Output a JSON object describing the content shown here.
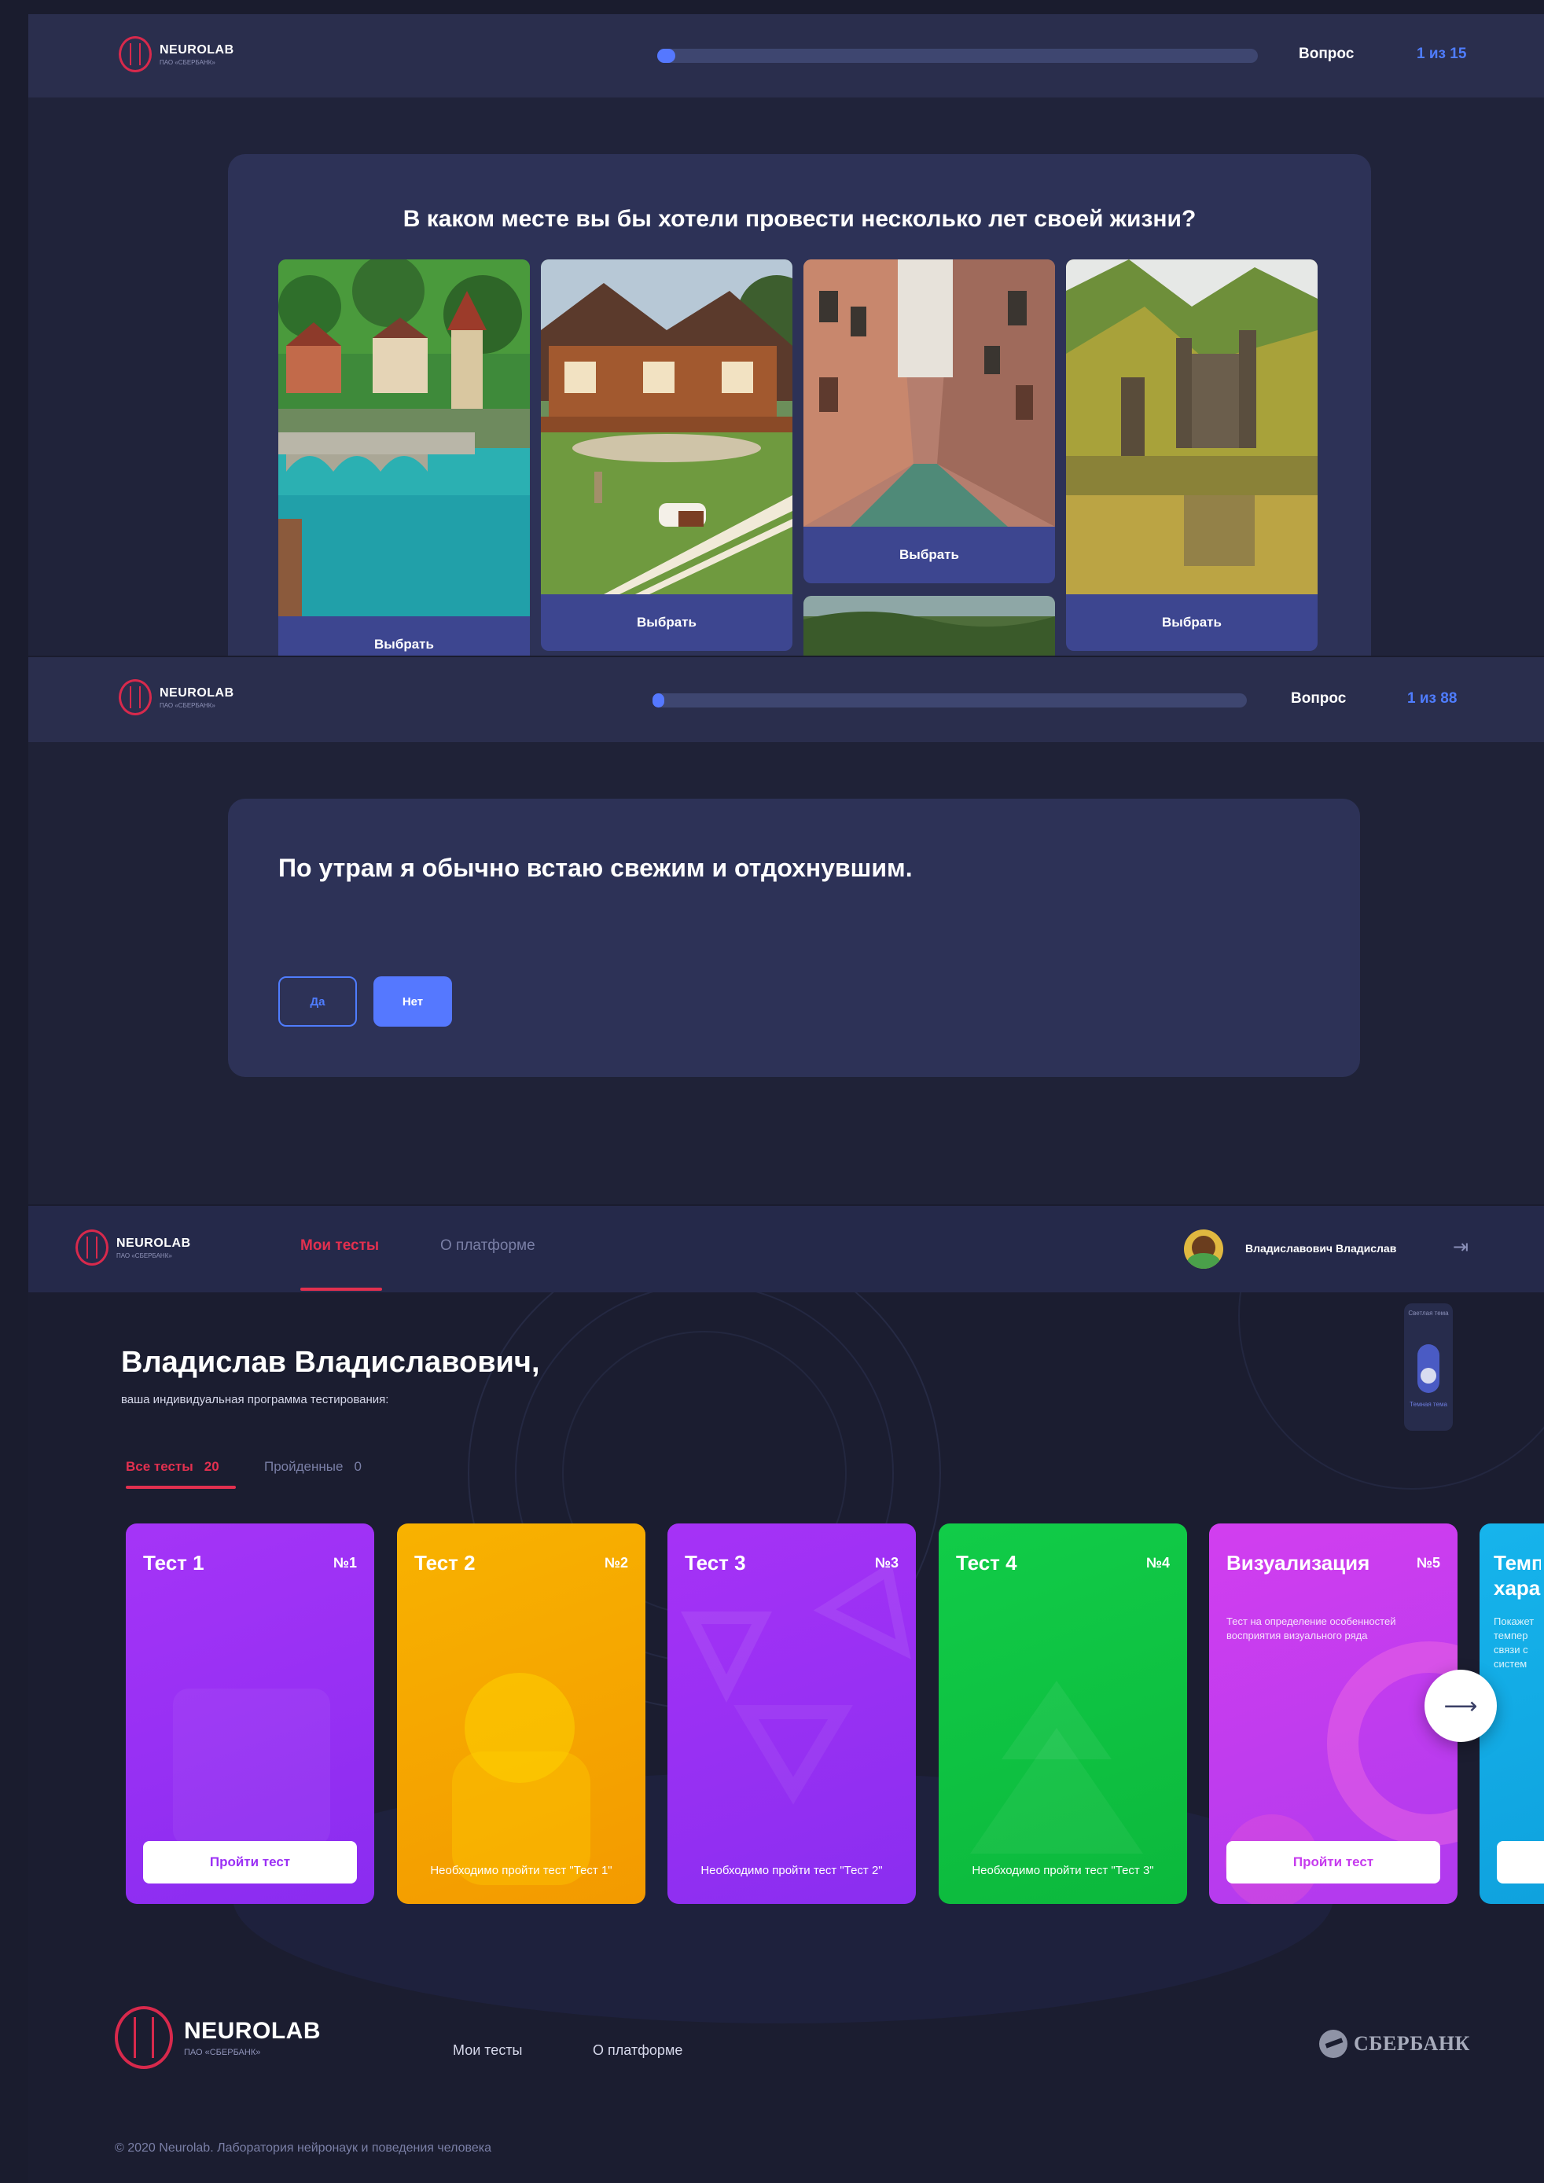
{
  "brand": {
    "name": "NEUROLAB",
    "sub": "ПАО «СБЕРБАНК»"
  },
  "screen1": {
    "question_label": "Вопрос",
    "question_count": "1 из 15",
    "progress": 0.03,
    "question": "В каком месте вы бы хотели провести несколько лет своей жизни?",
    "options": [
      {
        "label": "Выбрать",
        "image": "swiss-town-bridge"
      },
      {
        "label": "Выбрать",
        "image": "ranch-house-horse"
      },
      {
        "label": "Выбрать",
        "image": "venice-canal"
      },
      {
        "label": "Выбрать",
        "image": "castle-lake"
      }
    ]
  },
  "screen2": {
    "question_label": "Вопрос",
    "question_count": "1 из 88",
    "progress": 0.02,
    "question": "По утрам я обычно встаю свежим и отдохнувшим.",
    "yes_label": "Да",
    "no_label": "Нет"
  },
  "screen3": {
    "nav": {
      "my_tests": "Мои тесты",
      "about": "О платформе"
    },
    "user_name": "Владиславович Владислав",
    "theme_toggle": {
      "light": "Светлая тема",
      "dark": "Темная тема"
    },
    "greeting": "Владислав Владиславович,",
    "subtitle": "ваша индивидуальная программа тестирования:",
    "tabs": [
      {
        "label": "Все тесты",
        "count": "20"
      },
      {
        "label": "Пройденные",
        "count": "0"
      }
    ],
    "tests": [
      {
        "title": "Тест 1",
        "num": "№1",
        "desc": "",
        "action": "Пройти тест",
        "locked": false,
        "color": "#9b30f5"
      },
      {
        "title": "Тест 2",
        "num": "№2",
        "desc": "",
        "action": "Необходимо пройти тест \"Тест 1\"",
        "locked": true,
        "color": "#f5a300"
      },
      {
        "title": "Тест 3",
        "num": "№3",
        "desc": "",
        "action": "Необходимо пройти тест \"Тест 2\"",
        "locked": true,
        "color": "#9a2ef2"
      },
      {
        "title": "Тест 4",
        "num": "№4",
        "desc": "",
        "action": "Необходимо пройти тест \"Тест 3\"",
        "locked": true,
        "color": "#0fc244"
      },
      {
        "title": "Визуализация",
        "num": "№5",
        "desc": "Тест на определение особенностей восприятия визуального ряда",
        "action": "Пройти тест",
        "locked": false,
        "color": "#c63bee"
      },
      {
        "title": "Темп харак",
        "num": "",
        "desc": "Покажет темпер связи с систем",
        "action": "",
        "locked": false,
        "color": "#12aee8"
      }
    ],
    "footer": {
      "links": [
        "Мои тесты",
        "О платформе"
      ],
      "partner": "СБЕРБАНК",
      "copyright": "© 2020 Neurolab. Лаборатория нейронаук и поведения человека"
    }
  },
  "colors": {
    "accent": "#4f7dff",
    "active_tab": "#e2304f",
    "card": "#2d3257",
    "button": "#3d4690"
  }
}
